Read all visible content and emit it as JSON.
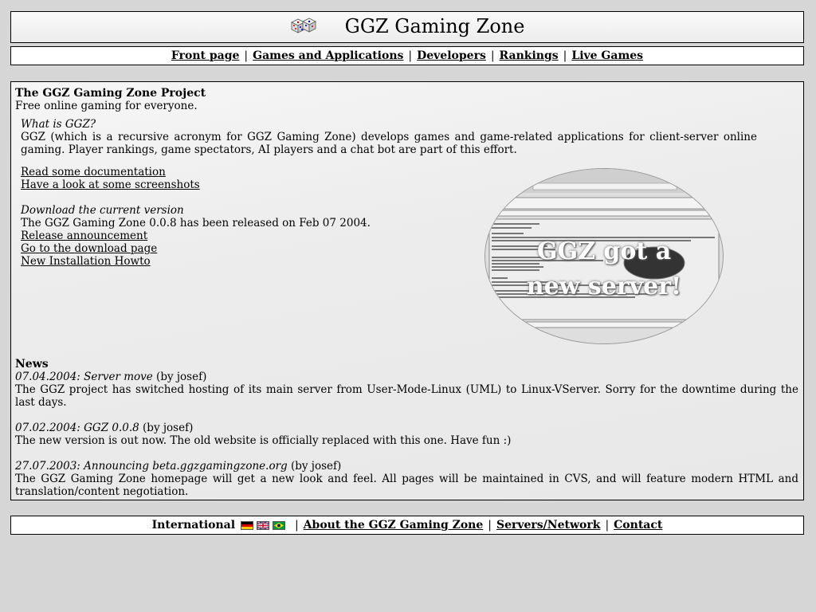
{
  "header": {
    "title": "GGZ Gaming Zone",
    "logo_icon": "dice-icon"
  },
  "nav": {
    "items": [
      "Front page",
      "Games and Applications",
      "Developers",
      "Rankings",
      "Live Games"
    ],
    "separator": "|"
  },
  "main": {
    "project_title": "The GGZ Gaming Zone Project",
    "tagline": "Free online gaming for everyone.",
    "what_heading": "What is GGZ?",
    "what_text": "GGZ (which is a recursive acronym for GGZ Gaming Zone) develops games and game-related applications for client-server online gaming. Player rankings, game spectators, AI players and a chat bot are part of this effort.",
    "links1": [
      "Read some documentation",
      "Have a look at some screenshots"
    ],
    "download_heading": "Download the current version",
    "download_text": "The GGZ Gaming Zone 0.0.8 has been released on Feb 07 2004.",
    "links2": [
      "Release announcement",
      "Go to the download page",
      "New Installation Howto"
    ],
    "screenshot_overlay": [
      "GGZ got a",
      "new server!"
    ],
    "news_heading": "News",
    "news": [
      {
        "date": "07.04.2004:",
        "title": "Server move",
        "author": "(by josef)",
        "text": "The GGZ project has switched hosting of its main server from User-Mode-Linux (UML) to Linux-VServer. Sorry for the downtime during the last days."
      },
      {
        "date": "07.02.2004:",
        "title": "GGZ 0.0.8",
        "author": "(by josef)",
        "text": "The new version is out now. The old website is officially replaced with this one. Have fun :)"
      },
      {
        "date": "27.07.2003:",
        "title": "Announcing beta.ggzgamingzone.org",
        "author": "(by josef)",
        "text": "The GGZ Gaming Zone homepage will get a new look and feel. All pages will be maintained in CVS, and will feature modern HTML and translation/content negotiation."
      }
    ]
  },
  "footer": {
    "international": "International",
    "flags": [
      "german-flag-icon",
      "uk-flag-icon",
      "brazil-flag-icon"
    ],
    "links": [
      "About the GGZ Gaming Zone",
      "Servers/Network",
      "Contact"
    ],
    "separator": "|"
  },
  "colors": {
    "background": "#d6d6d6",
    "box": "#ffffff",
    "border": "#000000",
    "text": "#000000"
  }
}
